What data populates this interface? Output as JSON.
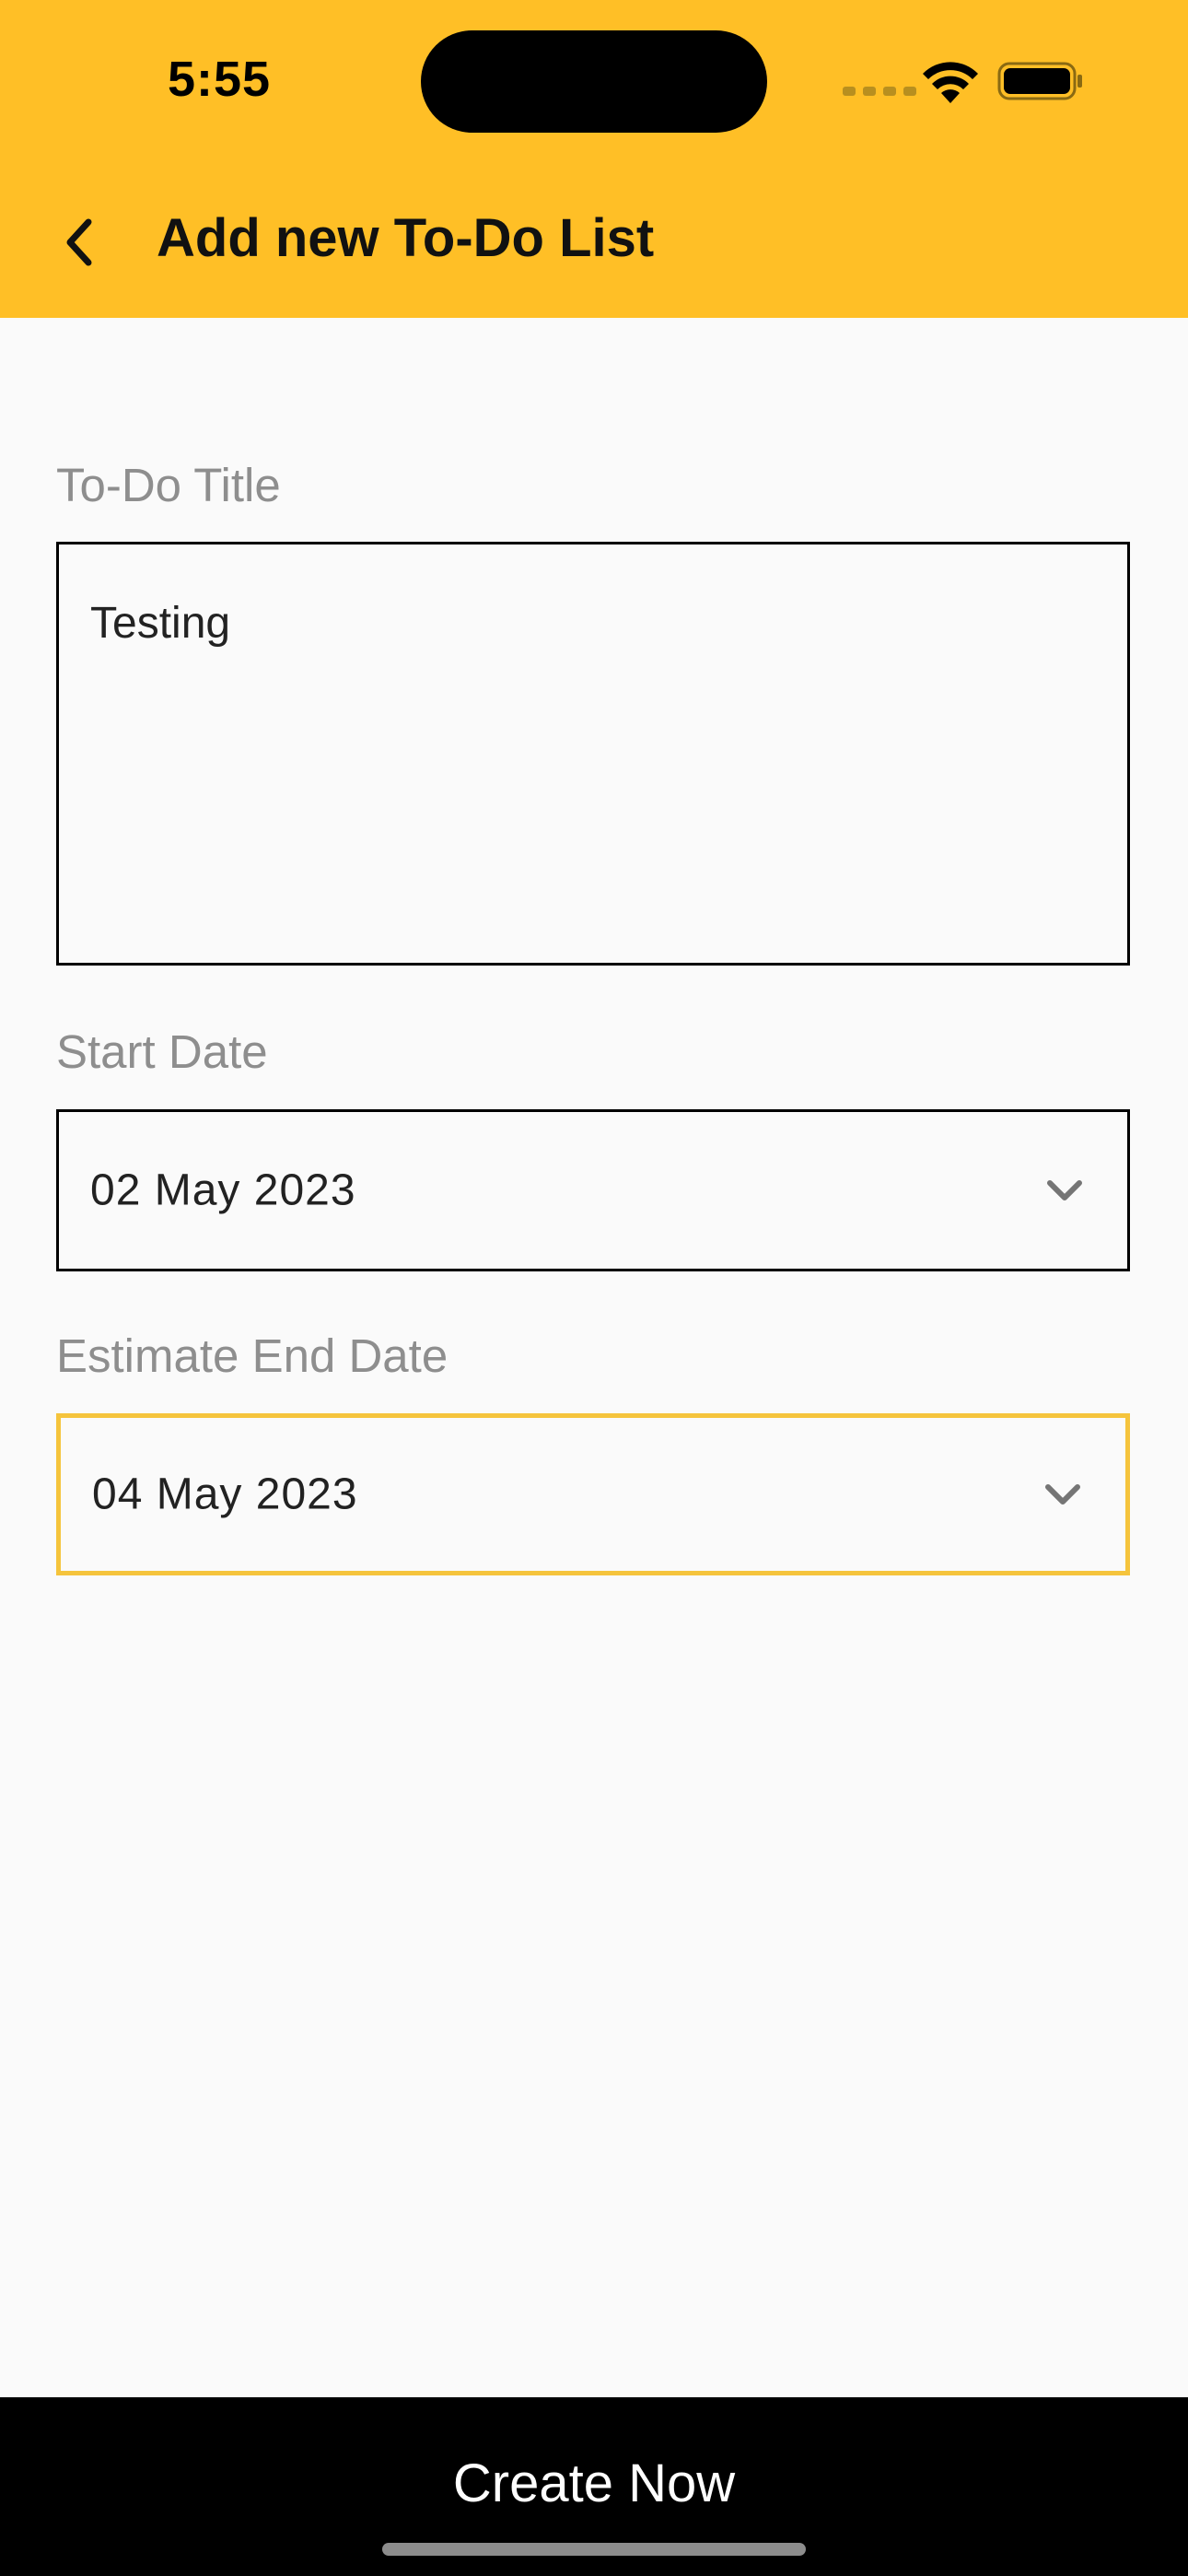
{
  "status_bar": {
    "time": "5:55"
  },
  "header": {
    "title": "Add new To-Do List",
    "back_icon": "chevron-left-icon",
    "background_color": "#FFBF26"
  },
  "form": {
    "title_label": "To-Do Title",
    "title_value": "Testing",
    "start_date_label": "Start Date",
    "start_date_value": "02 May 2023",
    "end_date_label": "Estimate End Date",
    "end_date_value": "04 May 2023",
    "focused_border_color": "#F5C43C"
  },
  "footer": {
    "create_label": "Create Now"
  }
}
